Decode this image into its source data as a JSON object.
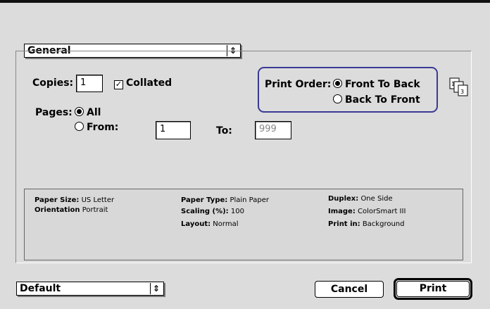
{
  "panel": {
    "selected": "General",
    "arrows": "⇕"
  },
  "copies": {
    "label": "Copies:",
    "value": "1",
    "collated_label": "Collated",
    "collated_checked": true
  },
  "print_order": {
    "label": "Print Order:",
    "front_to_back": "Front To Back",
    "back_to_front": "Back To Front",
    "selected": "front_to_back"
  },
  "pages": {
    "label": "Pages:",
    "all_label": "All",
    "from_label": "From:",
    "from_value": "1",
    "to_label": "To:",
    "to_value": "999",
    "selected": "all"
  },
  "summary": {
    "paper_size_label": "Paper Size:",
    "paper_size_value": "US Letter",
    "orientation_label": "Orientation",
    "orientation_value": "Portrait",
    "paper_type_label": "Paper Type:",
    "paper_type_value": "Plain Paper",
    "scaling_label": "Scaling (%):",
    "scaling_value": "100",
    "layout_label": "Layout:",
    "layout_value": "Normal",
    "duplex_label": "Duplex:",
    "duplex_value": "One Side",
    "image_label": "Image:",
    "image_value": "ColorSmart III",
    "print_in_label": "Print in:",
    "print_in_value": "Background"
  },
  "settings": {
    "selected": "Default"
  },
  "buttons": {
    "cancel": "Cancel",
    "print": "Print"
  },
  "icons": {
    "popup_arrows": "up-down-arrows-icon",
    "print_order": "page-order-icon"
  },
  "colors": {
    "highlight": "#3a3a94",
    "background": "#dcdcdc"
  }
}
